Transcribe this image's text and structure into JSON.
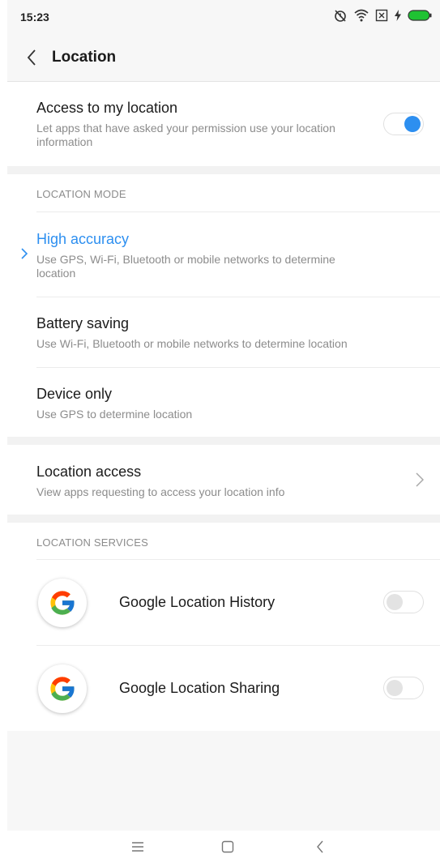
{
  "status_bar": {
    "time": "15:23"
  },
  "header": {
    "title": "Location"
  },
  "access": {
    "title": "Access to my location",
    "subtitle": "Let apps that have asked your permission use your location information",
    "enabled": true
  },
  "location_mode": {
    "header": "LOCATION MODE",
    "options": [
      {
        "title": "High accuracy",
        "subtitle": "Use GPS, Wi-Fi, Bluetooth or mobile networks to determine location",
        "selected": true
      },
      {
        "title": "Battery saving",
        "subtitle": "Use Wi-Fi, Bluetooth or mobile networks to determine location",
        "selected": false
      },
      {
        "title": "Device only",
        "subtitle": "Use GPS to determine location",
        "selected": false
      }
    ]
  },
  "location_access": {
    "title": "Location access",
    "subtitle": "View apps requesting to access your location info"
  },
  "location_services": {
    "header": "LOCATION SERVICES",
    "items": [
      {
        "label": "Google Location History",
        "enabled": false
      },
      {
        "label": "Google Location Sharing",
        "enabled": false
      }
    ]
  },
  "colors": {
    "accent": "#2d8ff0",
    "primary_text": "#1b1b1b",
    "secondary_text": "#8c8c8c"
  },
  "icons": [
    "back-arrow",
    "chevron-right",
    "google-logo",
    "menu",
    "home",
    "back"
  ]
}
